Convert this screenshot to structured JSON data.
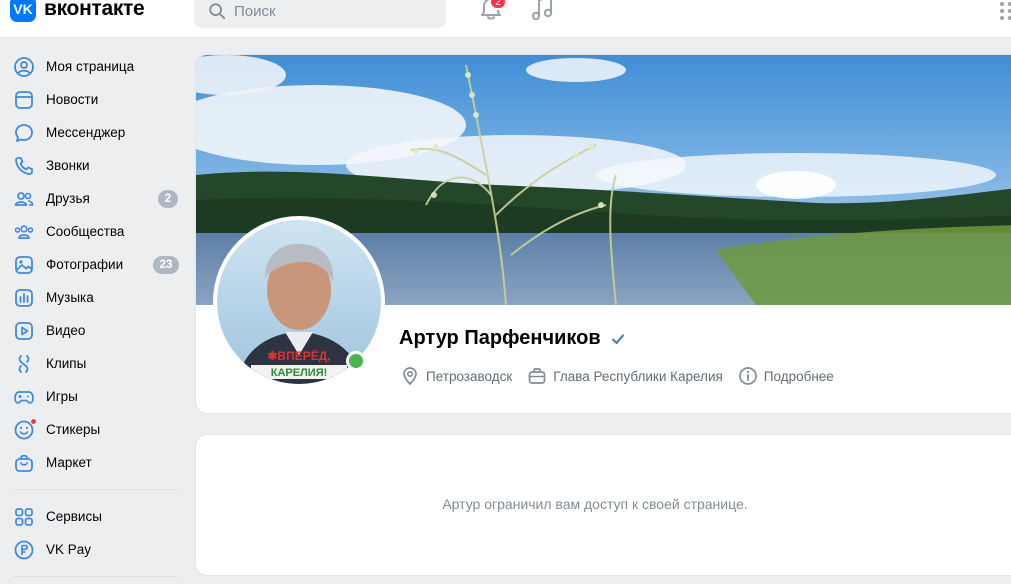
{
  "header": {
    "logo_mark": "VK",
    "logo_text": "вконтакте",
    "search_placeholder": "Поиск",
    "notifications_badge": "2",
    "icons": [
      "vk-logo",
      "search-icon",
      "bell-icon",
      "music-icon",
      "apps-icon"
    ]
  },
  "sidebar": {
    "items": [
      {
        "label": "Моя страница",
        "icon": "user-circle-icon"
      },
      {
        "label": "Новости",
        "icon": "news-icon"
      },
      {
        "label": "Мессенджер",
        "icon": "message-icon"
      },
      {
        "label": "Звонки",
        "icon": "phone-icon"
      },
      {
        "label": "Друзья",
        "icon": "friends-icon",
        "badge": "2"
      },
      {
        "label": "Сообщества",
        "icon": "communities-icon"
      },
      {
        "label": "Фотографии",
        "icon": "photo-icon",
        "badge": "23"
      },
      {
        "label": "Музыка",
        "icon": "music-bars-icon"
      },
      {
        "label": "Видео",
        "icon": "video-icon"
      },
      {
        "label": "Клипы",
        "icon": "clips-icon"
      },
      {
        "label": "Игры",
        "icon": "gamepad-icon"
      },
      {
        "label": "Стикеры",
        "icon": "sticker-icon"
      },
      {
        "label": "Маркет",
        "icon": "market-icon"
      }
    ],
    "items2": [
      {
        "label": "Сервисы",
        "icon": "services-icon"
      },
      {
        "label": "VK Pay",
        "icon": "vkpay-icon"
      }
    ]
  },
  "profile": {
    "name": "Артур Парфенчиков",
    "city": "Петрозаводск",
    "job": "Глава Республики Карелия",
    "more": "Подробнее",
    "avatar_banner_line1": "✱ВПЕРЁД,",
    "avatar_banner_line2": "КАРЕЛИЯ!",
    "online": true
  },
  "private_message": "Артур ограничил вам доступ к своей странице.",
  "colors": {
    "accent": "#0077ff",
    "page_bg": "#edeef0",
    "badge_gray": "#aeb7c2",
    "notification_red": "#ff3347",
    "online_green": "#4bb34b"
  }
}
